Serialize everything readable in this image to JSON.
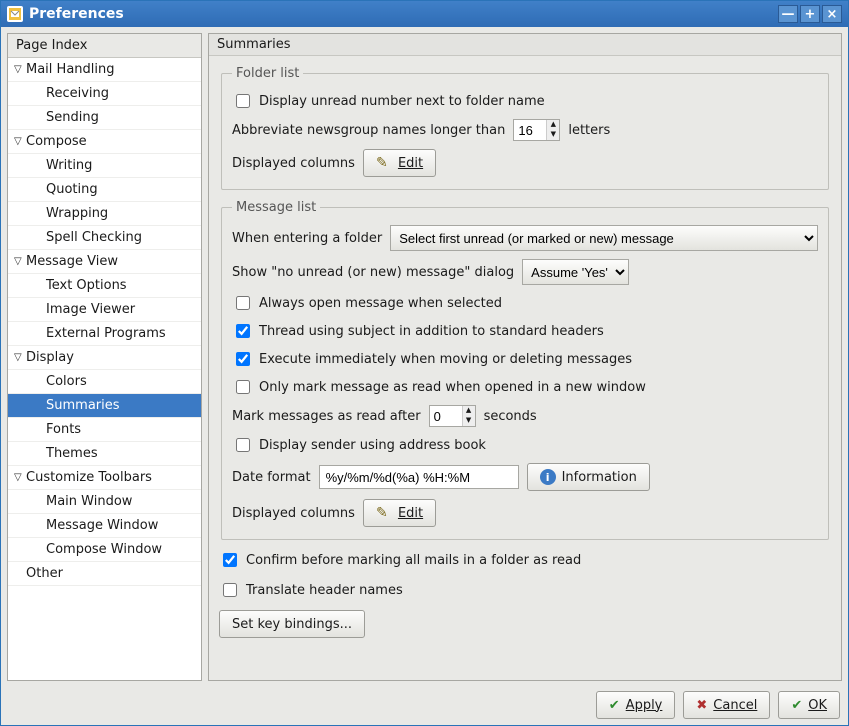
{
  "window": {
    "title": "Preferences"
  },
  "sidebar": {
    "header": "Page Index",
    "groups": [
      {
        "title": "Mail Handling",
        "items": [
          "Receiving",
          "Sending"
        ]
      },
      {
        "title": "Compose",
        "items": [
          "Writing",
          "Quoting",
          "Wrapping",
          "Spell Checking"
        ]
      },
      {
        "title": "Message View",
        "items": [
          "Text Options",
          "Image Viewer",
          "External Programs"
        ]
      },
      {
        "title": "Display",
        "items": [
          "Colors",
          "Summaries",
          "Fonts",
          "Themes"
        ]
      },
      {
        "title": "Customize Toolbars",
        "items": [
          "Main Window",
          "Message Window",
          "Compose Window"
        ]
      }
    ],
    "extra_item": "Other",
    "selected": "Summaries"
  },
  "page": {
    "title": "Summaries",
    "folder_list": {
      "legend": "Folder list",
      "display_unread": {
        "checked": false,
        "label": "Display unread number next to folder name"
      },
      "abbrev_prefix": "Abbreviate newsgroup names longer than",
      "abbrev_value": "16",
      "abbrev_suffix": "letters",
      "displayed_columns_label": "Displayed columns",
      "edit_button": "Edit"
    },
    "message_list": {
      "legend": "Message list",
      "when_entering_label": "When entering a folder",
      "when_entering_value": "Select first unread (or marked or new) message",
      "no_unread_label": "Show \"no unread (or new) message\" dialog",
      "no_unread_value": "Assume 'Yes'",
      "always_open": {
        "checked": false,
        "label": "Always open message when selected"
      },
      "thread_subject": {
        "checked": true,
        "label": "Thread using subject in addition to standard headers"
      },
      "execute_immediately": {
        "checked": true,
        "label": "Execute immediately when moving or deleting messages"
      },
      "only_mark_window": {
        "checked": false,
        "label": "Only mark message as read when opened in a new window"
      },
      "mark_read_prefix": "Mark messages as read after",
      "mark_read_value": "0",
      "mark_read_suffix": "seconds",
      "display_sender_ab": {
        "checked": false,
        "label": "Display sender using address book"
      },
      "date_format_label": "Date format",
      "date_format_value": "%y/%m/%d(%a) %H:%M",
      "information_button": "Information",
      "displayed_columns_label": "Displayed columns",
      "edit_button": "Edit"
    },
    "confirm_mark_all": {
      "checked": true,
      "label": "Confirm before marking all mails in a folder as read"
    },
    "translate_headers": {
      "checked": false,
      "label": "Translate header names"
    },
    "set_key_bindings": "Set key bindings..."
  },
  "footer": {
    "apply": "Apply",
    "cancel": "Cancel",
    "ok": "OK"
  }
}
